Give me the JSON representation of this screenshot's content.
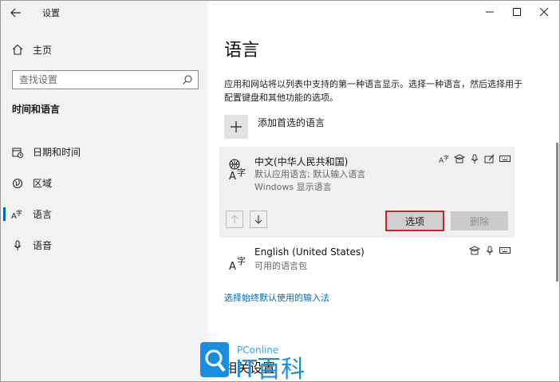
{
  "window": {
    "title": "设置",
    "back_icon": "back-arrow-icon",
    "controls": [
      "minimize-icon",
      "maximize-icon",
      "close-icon"
    ]
  },
  "sidebar": {
    "home_label": "主页",
    "search_placeholder": "查找设置",
    "section_title": "时间和语言",
    "items": [
      {
        "label": "日期和时间",
        "icon": "calendar-clock-icon",
        "active": false
      },
      {
        "label": "区域",
        "icon": "globe-region-icon",
        "active": false
      },
      {
        "label": "语言",
        "icon": "language-icon",
        "active": true
      },
      {
        "label": "语音",
        "icon": "microphone-icon",
        "active": false
      }
    ]
  },
  "main": {
    "title": "语言",
    "description": "应用和网站将以列表中支持的第一种语言显示。选择一种语言，然后选择用于配置键盘和其他功能的选项。",
    "add_language_label": "添加首选的语言",
    "languages": [
      {
        "name": "中文(中华人民共和国)",
        "line2": "默认应用语言; 默认输入语言",
        "line3": "Windows 显示语言",
        "features": [
          "display-language-icon",
          "speech-icon",
          "microphone-icon",
          "handwriting-icon",
          "keyboard-icon"
        ],
        "options_label": "选项",
        "remove_label": "删除"
      },
      {
        "name": "English (United States)",
        "line2": "可用的语言包",
        "features": [
          "speech-icon",
          "microphone-icon",
          "keyboard-icon"
        ]
      }
    ],
    "input_method_link": "选择始终默认使用的输入法",
    "related_title": "相关设置"
  },
  "watermark": {
    "brand": "PConline",
    "text": "IT百科"
  },
  "colors": {
    "accent": "#0067b8",
    "highlight_border": "#c0282e",
    "sidebar_bg": "#f2f2f2",
    "card_bg": "#f0f0f0"
  }
}
